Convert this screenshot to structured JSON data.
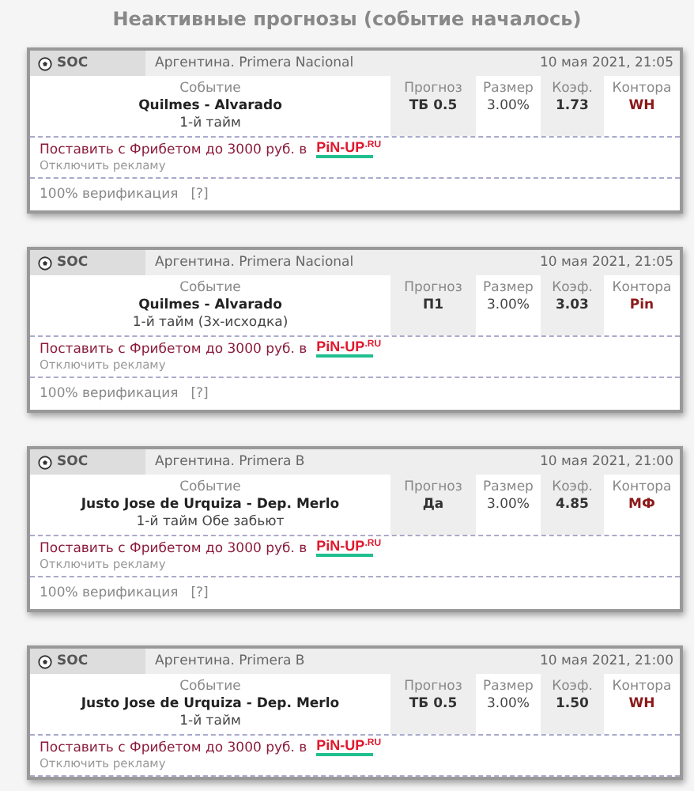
{
  "title": "Неактивные прогнозы (событие началось)",
  "cards": [
    {
      "sport": "SOC",
      "league": "Аргентина. Primera Nacional",
      "datetime": "10 мая 2021, 21:05",
      "labels": {
        "event": "Событие",
        "pick": "Прогноз",
        "stake": "Размер",
        "odds": "Коэф.",
        "bookmaker": "Контора"
      },
      "match": "Quilmes - Alvarado",
      "period": "1-й тайм",
      "pick": "ТБ 0.5",
      "stake": "3.00%",
      "odds": "1.73",
      "bookmaker": "WH",
      "ad_text": "Поставить с Фрибетом до 3000 руб. в",
      "ad_logo": "PiN-UP",
      "ad_logo_suffix": ".RU",
      "ad_disable": "Отключить рекламу",
      "verification": "100% верификация",
      "help": "[?]"
    },
    {
      "sport": "SOC",
      "league": "Аргентина. Primera Nacional",
      "datetime": "10 мая 2021, 21:05",
      "labels": {
        "event": "Событие",
        "pick": "Прогноз",
        "stake": "Размер",
        "odds": "Коэф.",
        "bookmaker": "Контора"
      },
      "match": "Quilmes - Alvarado",
      "period": "1-й тайм (3х-исходка)",
      "pick": "П1",
      "stake": "3.00%",
      "odds": "3.03",
      "bookmaker": "Pin",
      "ad_text": "Поставить с Фрибетом до 3000 руб. в",
      "ad_logo": "PiN-UP",
      "ad_logo_suffix": ".RU",
      "ad_disable": "Отключить рекламу",
      "verification": "100% верификация",
      "help": "[?]"
    },
    {
      "sport": "SOC",
      "league": "Аргентина. Primera B",
      "datetime": "10 мая 2021, 21:00",
      "labels": {
        "event": "Событие",
        "pick": "Прогноз",
        "stake": "Размер",
        "odds": "Коэф.",
        "bookmaker": "Контора"
      },
      "match": "Justo Jose de Urquiza - Dep. Merlo",
      "period": "1-й тайм Обе забьют",
      "pick": "Да",
      "stake": "3.00%",
      "odds": "4.85",
      "bookmaker": "МФ",
      "ad_text": "Поставить с Фрибетом до 3000 руб. в",
      "ad_logo": "PiN-UP",
      "ad_logo_suffix": ".RU",
      "ad_disable": "Отключить рекламу",
      "verification": "100% верификация",
      "help": "[?]"
    },
    {
      "sport": "SOC",
      "league": "Аргентина. Primera B",
      "datetime": "10 мая 2021, 21:00",
      "labels": {
        "event": "Событие",
        "pick": "Прогноз",
        "stake": "Размер",
        "odds": "Коэф.",
        "bookmaker": "Контора"
      },
      "match": "Justo Jose de Urquiza - Dep. Merlo",
      "period": "1-й тайм",
      "pick": "ТБ 0.5",
      "stake": "3.00%",
      "odds": "1.50",
      "bookmaker": "WH",
      "ad_text": "Поставить с Фрибетом до 3000 руб. в",
      "ad_logo": "PiN-UP",
      "ad_logo_suffix": ".RU",
      "ad_disable": "Отключить рекламу"
    }
  ]
}
